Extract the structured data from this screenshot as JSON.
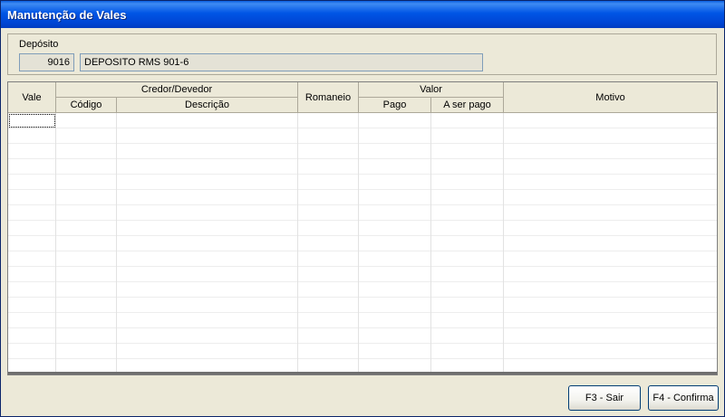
{
  "window": {
    "title": "Manutenção de Vales"
  },
  "deposito": {
    "label": "Depósito",
    "code": "9016",
    "name": "DEPOSITO RMS 901-6"
  },
  "grid": {
    "headers": {
      "vale": "Vale",
      "credor_devedor": "Credor/Devedor",
      "codigo": "Código",
      "descricao": "Descrição",
      "romaneio": "Romaneio",
      "valor": "Valor",
      "pago": "Pago",
      "a_ser_pago": "A ser pago",
      "motivo": "Motivo"
    },
    "rows": []
  },
  "buttons": {
    "sair": "F3 - Sair",
    "confirma": "F4 - Confirma"
  }
}
